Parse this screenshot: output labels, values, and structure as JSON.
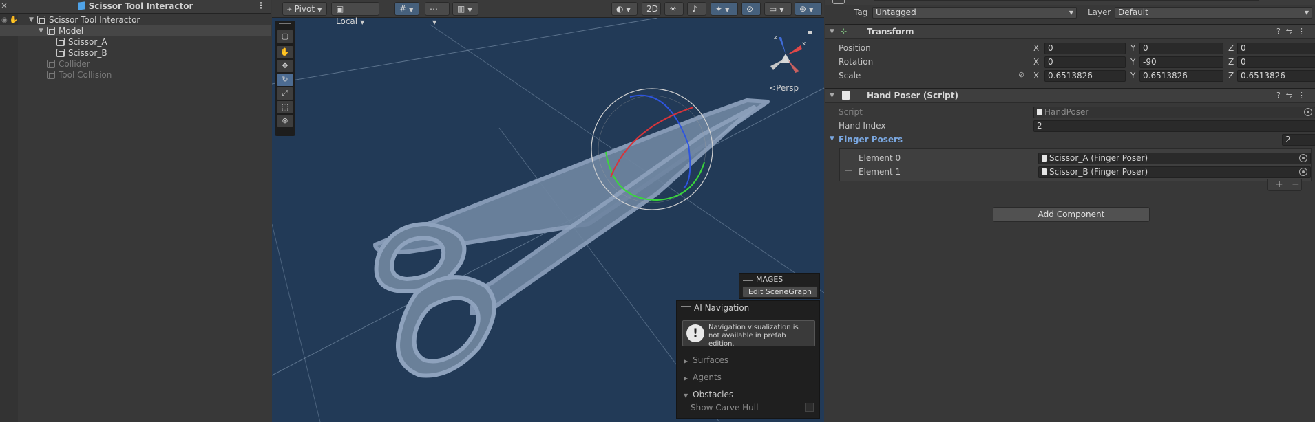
{
  "hierarchy": {
    "title": "Scissor Tool Interactor",
    "items": [
      {
        "label": "Scissor Tool Interactor"
      },
      {
        "label": "Model"
      },
      {
        "label": "Scissor_A"
      },
      {
        "label": "Scissor_B"
      },
      {
        "label": "Collider"
      },
      {
        "label": "Tool Collision"
      }
    ]
  },
  "scene_toolbar": {
    "pivot": "Pivot",
    "space": "Local",
    "mode_2d": "2D"
  },
  "scene": {
    "persp_label": "Persp",
    "axis_x": "x",
    "axis_z": "z"
  },
  "mages": {
    "title": "MAGES",
    "button": "Edit SceneGraph"
  },
  "ai_navigation": {
    "title": "AI Navigation",
    "warning": "Navigation visualization is not available in prefab edition.",
    "sections": [
      "Surfaces",
      "Agents",
      "Obstacles"
    ],
    "show_carve_hull": "Show Carve Hull"
  },
  "inspector": {
    "tag_label": "Tag",
    "tag_value": "Untagged",
    "layer_label": "Layer",
    "layer_value": "Default",
    "transform": {
      "title": "Transform",
      "position": {
        "label": "Position",
        "x": "0",
        "y": "0",
        "z": "0"
      },
      "rotation": {
        "label": "Rotation",
        "x": "0",
        "y": "-90",
        "z": "0"
      },
      "scale": {
        "label": "Scale",
        "x": "0.6513826",
        "y": "0.6513826",
        "z": "0.6513826"
      }
    },
    "hand_poser": {
      "title": "Hand Poser (Script)",
      "script_label": "Script",
      "script_value": "HandPoser",
      "hand_index_label": "Hand Index",
      "hand_index_value": "2",
      "finger_posers_label": "Finger Posers",
      "finger_posers_count": "2",
      "elements": [
        {
          "label": "Element 0",
          "value": "Scissor_A (Finger Poser)"
        },
        {
          "label": "Element 1",
          "value": "Scissor_B (Finger Poser)"
        }
      ]
    },
    "add_component": "Add Component"
  },
  "colors": {
    "scene_bg": "#223a57",
    "rotate_x": "#d8343a",
    "rotate_y": "#3ad83a",
    "rotate_z": "#2e55e0",
    "link_blue": "#7aa7e0"
  }
}
